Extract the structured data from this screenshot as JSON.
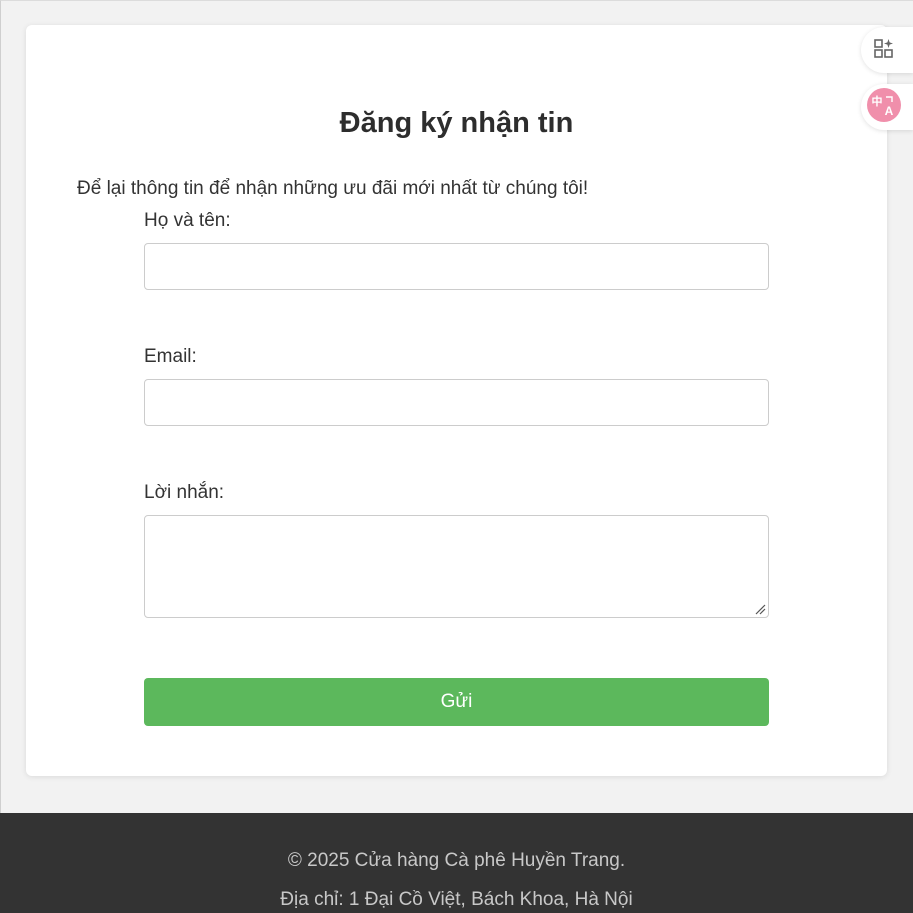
{
  "form": {
    "title": "Đăng ký nhận tin",
    "intro": "Để lại thông tin để nhận những ưu đãi mới nhất từ chúng tôi!",
    "name_label": "Họ và tên:",
    "name_value": "",
    "email_label": "Email:",
    "email_value": "",
    "message_label": "Lời nhắn:",
    "message_value": "",
    "submit_label": "Gửi"
  },
  "footer": {
    "copyright": "© 2025 Cửa hàng Cà phê Huyền Trang.",
    "address": "Địa chỉ: 1 Đại Cồ Việt, Bách Khoa, Hà Nội"
  },
  "side_tools": [
    {
      "icon": "apps-sparkle-icon"
    },
    {
      "icon": "translate-icon"
    }
  ],
  "colors": {
    "accent_button": "#5cb85c",
    "footer_bg": "#333333",
    "page_bg": "#f2f2f2",
    "translate_badge": "#f08fab"
  }
}
